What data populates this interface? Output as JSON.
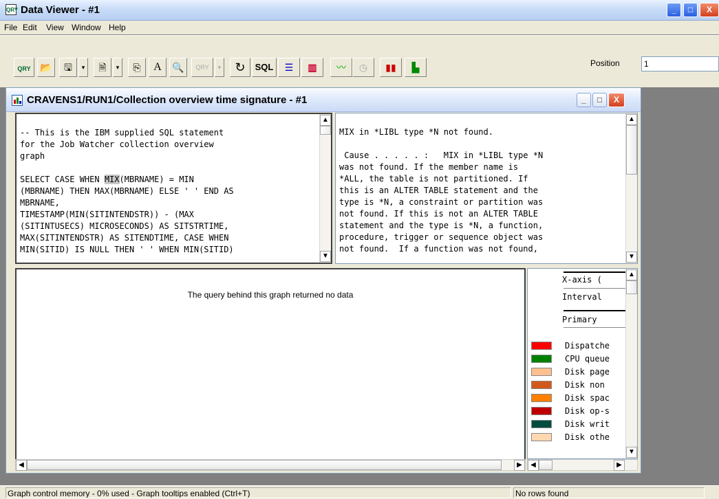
{
  "window": {
    "title": "Data Viewer - #1",
    "icon": "qry-app-icon"
  },
  "menu": [
    "File",
    "Edit",
    "View",
    "Window",
    "Help"
  ],
  "toolbar": {
    "sql_label": "SQL",
    "text_label": "A",
    "position_label": "Position",
    "position_value": "1"
  },
  "graph_window": {
    "title": "CRAVENS1/RUN1/Collection overview time signature - #1",
    "sql_lines": [
      "-- This is the IBM supplied SQL statement",
      "for the Job Watcher collection overview",
      "graph",
      "",
      "SELECT CASE WHEN MIX(MBRNAME) = MIN",
      "(MBRNAME) THEN MAX(MBRNAME) ELSE ' ' END AS",
      "MBRNAME,",
      "TIMESTAMP(MIN(SITINTENDSTR)) - (MAX",
      "(SITINTUSECS) MICROSECONDS) AS SITSTRTIME,",
      "MAX(SITINTENDSTR) AS SITENDTIME, CASE WHEN",
      "MIN(SITID) IS NULL THEN ' ' WHEN MIN(SITID)"
    ],
    "message_lines": [
      "MIX in *LIBL type *N not found.",
      "",
      " Cause . . . . . :   MIX in *LIBL type *N",
      "was not found. If the member name is",
      "*ALL, the table is not partitioned. If",
      "this is an ALTER TABLE statement and the",
      "type is *N, a constraint or partition was",
      "not found. If this is not an ALTER TABLE",
      "statement and the type is *N, a function,",
      "procedure, trigger or sequence object was",
      "not found.  If a function was not found,"
    ],
    "graph_message": "The query behind this graph returned no data",
    "legend": {
      "xaxis_label": "X-axis (",
      "interval_label": "Interval",
      "primary_label": "Primary",
      "items": [
        {
          "label": "Dispatche",
          "color": "#ff0000"
        },
        {
          "label": "CPU queue",
          "color": "#008000"
        },
        {
          "label": "Disk page",
          "color": "#ffc090"
        },
        {
          "label": "Disk non",
          "color": "#d2591b"
        },
        {
          "label": "Disk spac",
          "color": "#ff8000"
        },
        {
          "label": "Disk op-s",
          "color": "#c00000"
        },
        {
          "label": "Disk writ",
          "color": "#004d40"
        },
        {
          "label": "Disk othe",
          "color": "#ffd8b0"
        }
      ]
    }
  },
  "status": {
    "left": "Graph control memory - 0% used - Graph tooltips enabled (Ctrl+T)",
    "right": "No rows found"
  }
}
